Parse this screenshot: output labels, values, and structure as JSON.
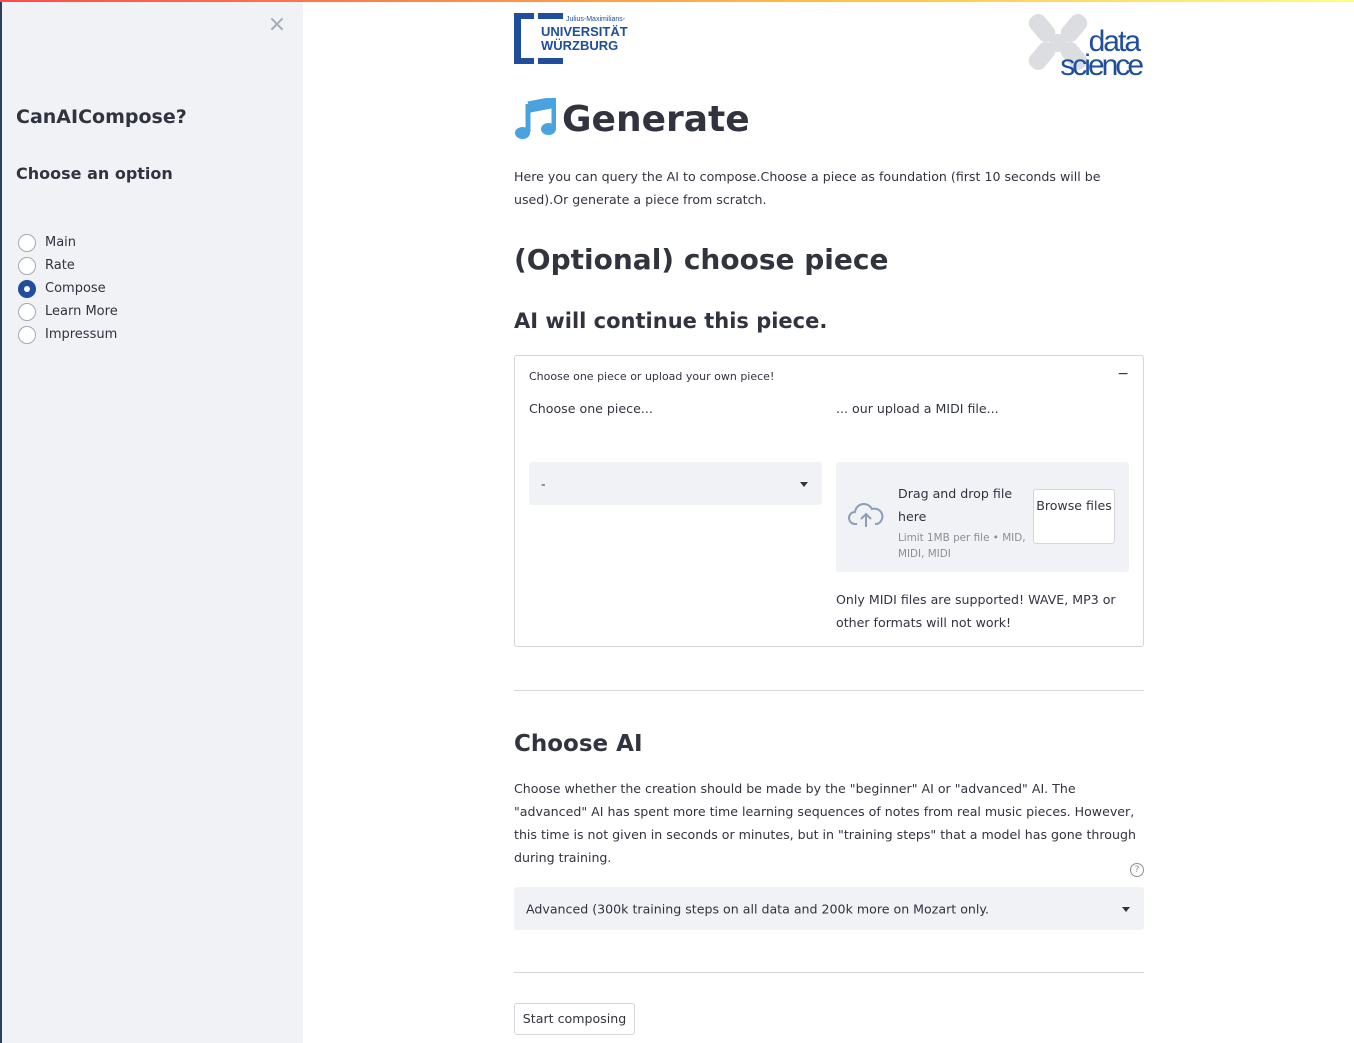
{
  "sidebar": {
    "close_icon": "×",
    "title": "CanAICompose?",
    "subtitle": "Choose an option",
    "options": [
      {
        "label": "Main",
        "selected": false
      },
      {
        "label": "Rate",
        "selected": false
      },
      {
        "label": "Compose",
        "selected": true
      },
      {
        "label": "Learn More",
        "selected": false
      },
      {
        "label": "Impressum",
        "selected": false
      }
    ]
  },
  "logos": {
    "university": {
      "small": "Julius-Maximilians-",
      "line1": "UNIVERSITÄT",
      "line2": "WÜRZBURG"
    },
    "datascience": {
      "line1": "data",
      "line2": "science"
    }
  },
  "main": {
    "title": "Generate",
    "title_icon": "musical-note-icon",
    "intro": "Here you can query the AI to compose.Choose a piece as foundation (first 10 seconds will be used).Or generate a piece from scratch.",
    "section_title": "(Optional) choose piece",
    "section_subtitle": "AI will continue this piece.",
    "expander": {
      "label": "Choose one piece or upload your own piece!",
      "toggle": "−",
      "left_label": "Choose one piece...",
      "right_label": "... our upload a MIDI file...",
      "select_value": "-",
      "uploader": {
        "title": "Drag and drop file here",
        "limit": "Limit 1MB per file • MID, MIDI, MIDI",
        "browse": "Browse files"
      },
      "note": "Only MIDI files are supported! WAVE, MP3 or other formats will not work!"
    },
    "ai": {
      "title": "Choose AI",
      "description": "Choose whether the creation should be made by the \"beginner\" AI or \"advanced\" AI. The \"advanced\" AI has spent more time learning sequences of notes from real music pieces. However, this time is not given in seconds or minutes, but in \"training steps\" that a model has gone through during training.",
      "help_icon": "?",
      "select_value": "Advanced (300k training steps on all data and 200k more on Mozart only."
    },
    "start_button": "Start composing"
  },
  "colors": {
    "sidebar_bg": "#f0f2f6",
    "accent": "#1f4e9c",
    "text": "#31333f",
    "note_icon": "#4aa3df"
  }
}
